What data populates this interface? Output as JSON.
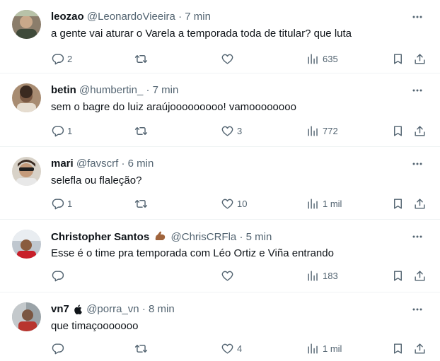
{
  "tweets": [
    {
      "name": "leozao",
      "handle": "@LeonardoVieeira",
      "time": "7 min",
      "text": "a gente vai aturar o Varela a temporada toda de titular? que luta",
      "replies": "2",
      "retweets": "",
      "likes": "",
      "views": "635"
    },
    {
      "name": "betin",
      "handle": "@humbertin_",
      "time": "7 min",
      "text": "sem o bagre do luiz araújooooooooo! vamoooooooo",
      "replies": "1",
      "retweets": "",
      "likes": "3",
      "views": "772"
    },
    {
      "name": "mari",
      "handle": "@favscrf",
      "time": "6 min",
      "text": "selefla ou flaleção?",
      "replies": "1",
      "retweets": "",
      "likes": "10",
      "views": "1 mil"
    },
    {
      "name": "Christopher Santos",
      "handle": "@ChrisCRFla",
      "time": "5 min",
      "text": "Esse é o time pra temporada com Léo Ortiz e Viña entrando",
      "replies": "",
      "retweets": "",
      "likes": "",
      "views": "183"
    },
    {
      "name": "vn7",
      "handle": "@porra_vn",
      "time": "8 min",
      "text": "que timaçooooooo",
      "replies": "",
      "retweets": "",
      "likes": "4",
      "views": "1 mil"
    }
  ],
  "separator": "·",
  "colors": {
    "text": "#0f1419",
    "secondary": "#536471",
    "border": "#eff3f4"
  },
  "icons": {
    "reply": "reply-icon",
    "retweet": "retweet-icon",
    "like": "heart-icon",
    "views": "views-icon",
    "bookmark": "bookmark-icon",
    "share": "share-icon",
    "more": "more-icon"
  }
}
